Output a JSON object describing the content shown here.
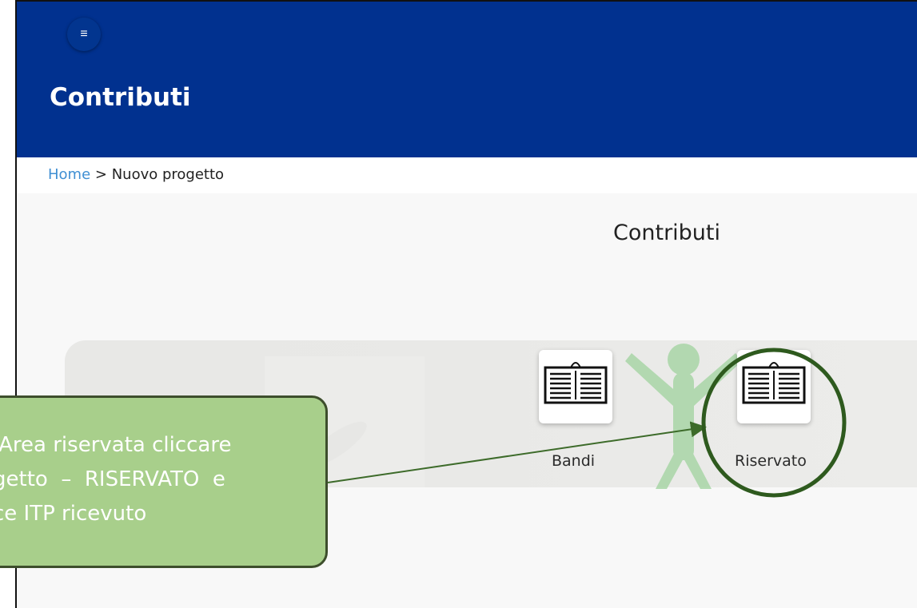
{
  "header": {
    "menu_icon": "≡",
    "title": "Contributi",
    "background": "#01318f"
  },
  "breadcrumb": {
    "home": "Home",
    "separator": ">",
    "current": "Nuovo progetto"
  },
  "main": {
    "heading": "Contributi",
    "tiles": [
      {
        "label": "Bandi",
        "icon": "document-icon"
      },
      {
        "label": "Riservato",
        "icon": "document-icon"
      }
    ]
  },
  "annotation": {
    "line1": "'Area riservata cliccare",
    "line2": "getto  –  RISERVATO  e",
    "line3": "ce ITP ricevuto",
    "highlight_color": "#2e5a1e",
    "callout_color": "#a8cf8b"
  }
}
